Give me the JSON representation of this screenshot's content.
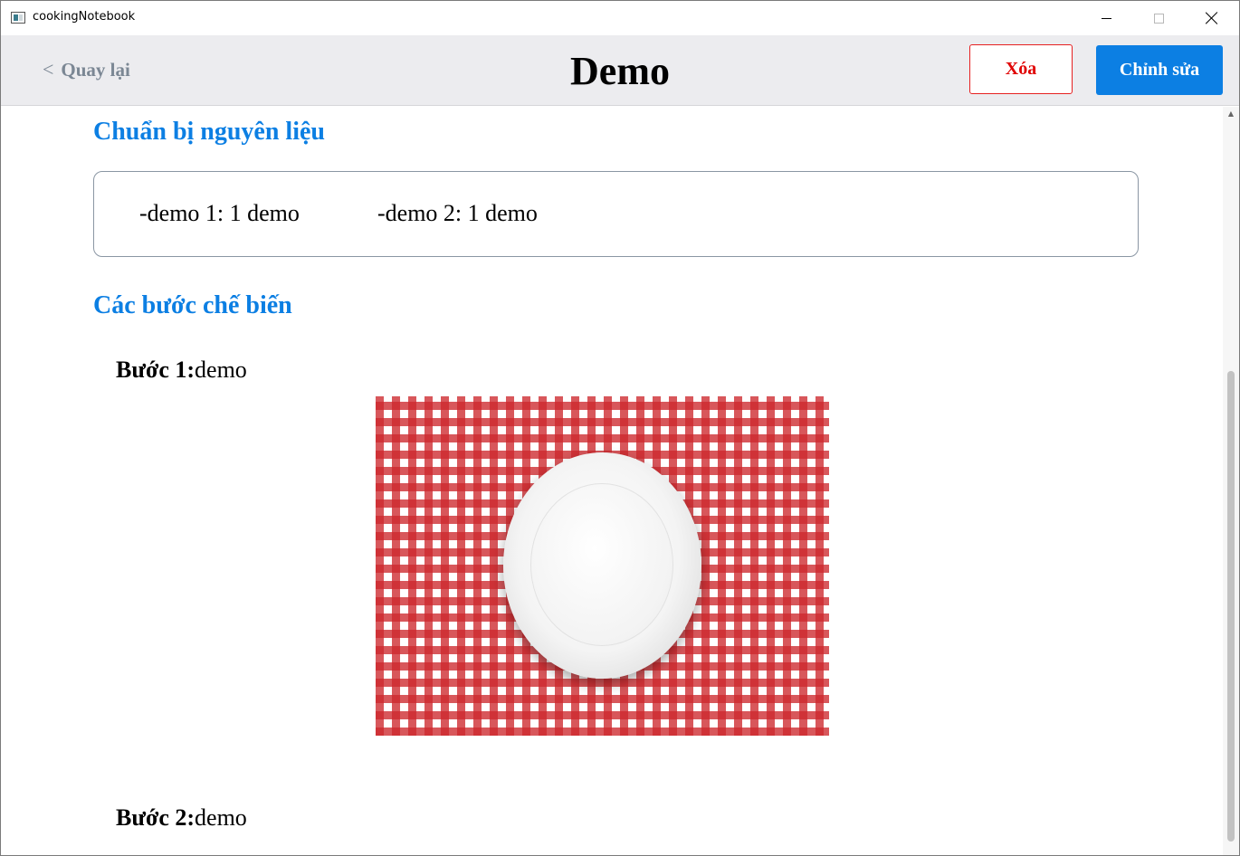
{
  "window": {
    "title": "cookingNotebook"
  },
  "header": {
    "back_label": "Quay lại",
    "back_chevron": "<",
    "title": "Demo",
    "delete_label": "Xóa",
    "edit_label": "Chỉnh sửa"
  },
  "ingredients": {
    "heading": "Chuẩn bị nguyên liệu",
    "items": [
      "-demo 1: 1 demo",
      "-demo 2: 1 demo"
    ]
  },
  "steps": {
    "heading": "Các bước chế biến",
    "items": [
      {
        "label": "Bước 1:",
        "text": "demo",
        "image": "red-checkered-tablecloth-white-plate"
      },
      {
        "label": "Bước 2:",
        "text": "demo"
      }
    ]
  },
  "colors": {
    "accent": "#0c7fe3",
    "danger": "#e00000",
    "header_bg": "#ececef"
  }
}
